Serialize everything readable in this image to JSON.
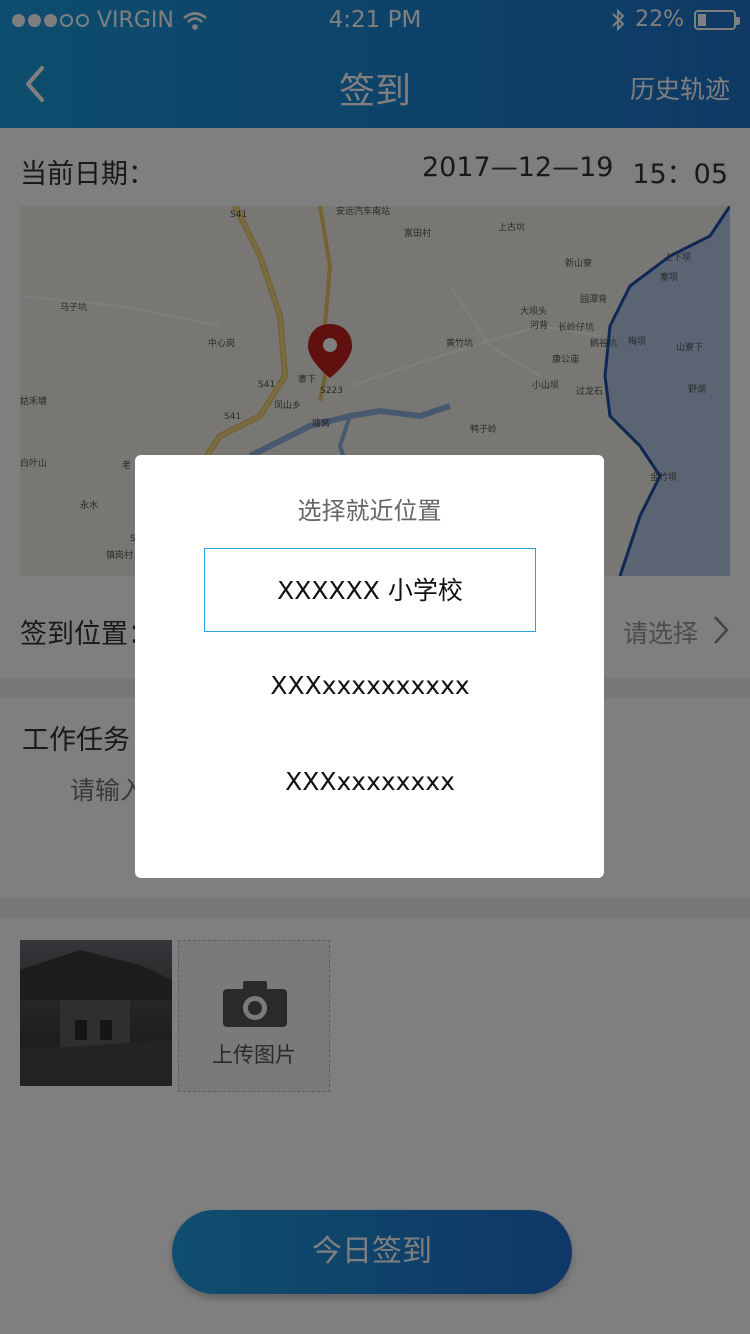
{
  "status": {
    "carrier": "VIRGIN",
    "time": "4:21 PM",
    "battery": "22%"
  },
  "nav": {
    "title": "签到",
    "history": "历史轨迹"
  },
  "date": {
    "label": "当前日期：",
    "date": "2017—12—19",
    "time": "15：05"
  },
  "map": {
    "labels": [
      "S41",
      "安远汽车南站",
      "富田村",
      "上古坑",
      "上下坝",
      "新山寮",
      "寨坝",
      "马子坑",
      "中心岗",
      "大坝头",
      "园潭背",
      "河背",
      "长岭仔坑",
      "黄竹坑",
      "鹅谷坑",
      "梅坝",
      "山寮下",
      "康公庙",
      "寨下",
      "S223",
      "S41",
      "小山坝",
      "过龙石",
      "野湖",
      "S41",
      "凤山乡",
      "塘窝",
      "姑禾塘",
      "鸭子岭",
      "白叶山",
      "老",
      "金竹坝",
      "永水",
      "镇岗村",
      "S223"
    ]
  },
  "location": {
    "label": "签到位置：",
    "choose": "请选择"
  },
  "task": {
    "label": "工作任务",
    "placeholder": "请输入"
  },
  "upload": {
    "label": "上传图片"
  },
  "sign_button": "今日签到",
  "dialog": {
    "title": "选择就近位置",
    "options": [
      "XXXXXX 小学校",
      "XXXxxxxxxxxxx",
      "XXXxxxxxxxx"
    ]
  }
}
